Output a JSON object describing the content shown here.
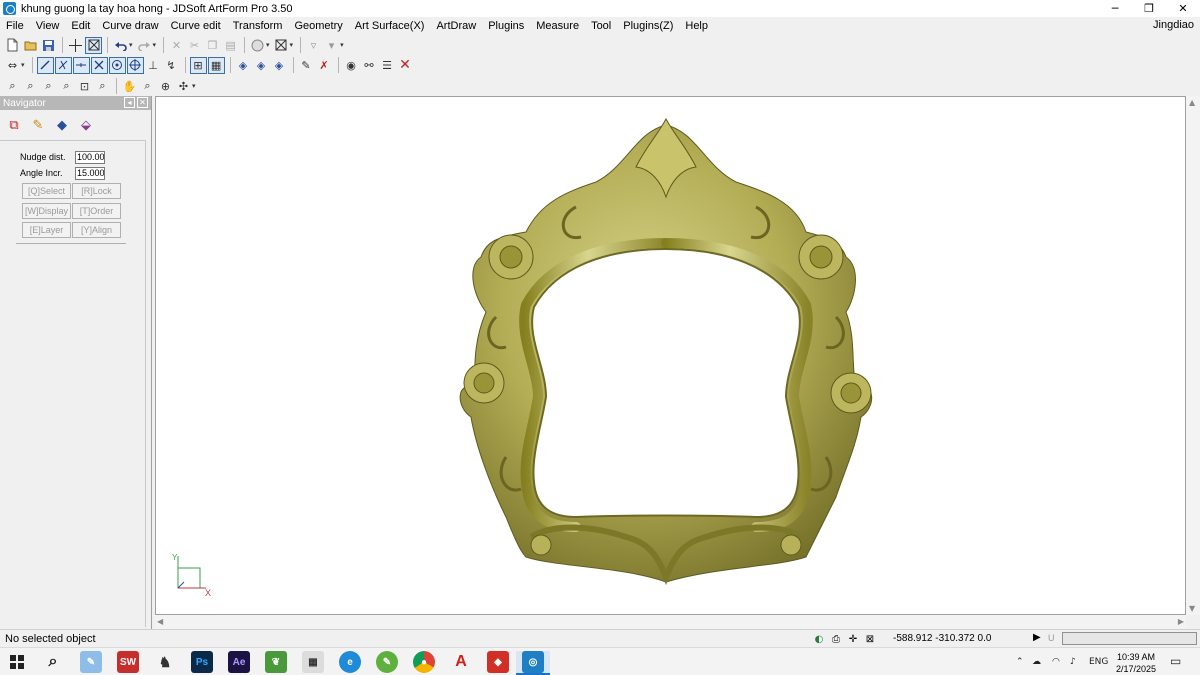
{
  "window": {
    "title": "khung guong la tay hoa hong - JDSoft ArtForm Pro 3.50",
    "minimize": "─",
    "restore": "❐",
    "close": "✕"
  },
  "menu": {
    "items": [
      "File",
      "View",
      "Edit",
      "Curve draw",
      "Curve edit",
      "Transform",
      "Geometry",
      "Art Surface(X)",
      "ArtDraw",
      "Plugins",
      "Measure",
      "Tool",
      "Plugins(Z)",
      "Help"
    ],
    "user": "Jingdiao"
  },
  "navigator": {
    "header": "Navigator",
    "nudge_label": "Nudge dist.",
    "nudge_value": "100.000",
    "angle_label": "Angle Incr.",
    "angle_value": "15.000",
    "buttons": {
      "select": "[Q]Select",
      "lock": "[R]Lock",
      "display": "[W]Display",
      "order": "[T]Order",
      "layer": "[E]Layer",
      "align": "[Y]Align"
    }
  },
  "viewport": {
    "axis_x": "X",
    "axis_y": "Y",
    "model_color": "#a8a34a"
  },
  "status": {
    "text": "No selected object",
    "coords": "-588.912 -310.372 0.0",
    "u_label": "U"
  },
  "taskbar": {
    "apps": [
      "start-icon",
      "search-icon",
      "paint-icon",
      "solidworks-icon",
      "figure-icon",
      "photoshop-icon",
      "after-effects-icon",
      "leaf-icon",
      "calculator-icon",
      "edge-icon",
      "pen-icon",
      "chrome-icon",
      "acrobat-icon",
      "sketchup-icon",
      "artform-icon"
    ],
    "ps_label": "Ps",
    "ae_label": "Ae",
    "sw_label": "SW",
    "acro_label": "A",
    "lang": "ENG",
    "time": "10:39 AM",
    "date": "2/17/2025"
  }
}
